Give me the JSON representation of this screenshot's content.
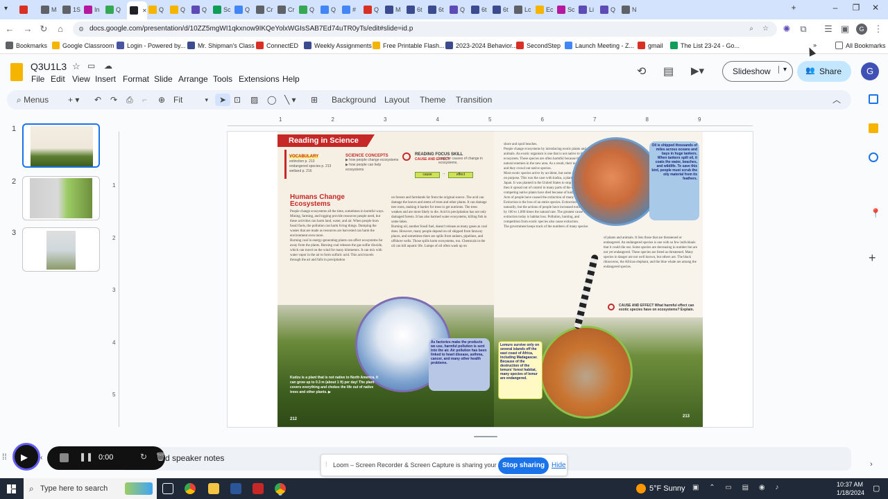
{
  "browser": {
    "tabs": [
      {
        "label": "",
        "color": "#d93025"
      },
      {
        "label": "M",
        "color": "#5f6368"
      },
      {
        "label": "1S",
        "color": "#5f6368"
      },
      {
        "label": "In",
        "color": "#b5179e"
      },
      {
        "label": "Q",
        "color": "#34a853"
      },
      {
        "label": "",
        "color": "#202124"
      },
      {
        "label": "Q",
        "color": "#f4b400"
      },
      {
        "label": "Q",
        "color": "#f4b400"
      },
      {
        "label": "Q",
        "color": "#5f4bb6"
      },
      {
        "label": "Sc",
        "color": "#0f9d58"
      },
      {
        "label": "Q",
        "color": "#4285f4"
      },
      {
        "label": "Cr",
        "color": "#5f6368"
      },
      {
        "label": "Cr",
        "color": "#5f6368"
      },
      {
        "label": "Q",
        "color": "#34a853"
      },
      {
        "label": "Q",
        "color": "#4285f4"
      },
      {
        "label": "#",
        "color": "#4285f4"
      },
      {
        "label": "Q",
        "color": "#d93025"
      },
      {
        "label": "M",
        "color": "#3c4a8f"
      },
      {
        "label": "6t",
        "color": "#3c4a8f"
      },
      {
        "label": "6t",
        "color": "#3c4a8f"
      },
      {
        "label": "Q",
        "color": "#5f4bb6"
      },
      {
        "label": "6t",
        "color": "#3c4a8f"
      },
      {
        "label": "6t",
        "color": "#3c4a8f"
      },
      {
        "label": "Lc",
        "color": "#5f6368"
      },
      {
        "label": "Ec",
        "color": "#f4b400"
      },
      {
        "label": "Sc",
        "color": "#b5179e"
      },
      {
        "label": "Li",
        "color": "#5f4bb6"
      },
      {
        "label": "Q",
        "color": "#5f4bb6"
      },
      {
        "label": "N",
        "color": "#5f6368"
      }
    ],
    "url": "docs.google.com/presentation/d/10ZZ5mgWI1qkxnow9IKQeYolxWGIsSAB7Ed74uTR0yTs/edit#slide=id.p",
    "bookmarks": [
      {
        "label": "Bookmarks",
        "color": "#5f6368"
      },
      {
        "label": "Google Classroom",
        "color": "#f4b400"
      },
      {
        "label": "Login - Powered by...",
        "color": "#4a55a2"
      },
      {
        "label": "Mr. Shipman's Class",
        "color": "#3c4a8f"
      },
      {
        "label": "ConnectED",
        "color": "#d93025"
      },
      {
        "label": "Weekly Assignments",
        "color": "#3c4a8f"
      },
      {
        "label": "Free Printable Flash...",
        "color": "#f4b400"
      },
      {
        "label": "2023-2024 Behavior...",
        "color": "#3c4a8f"
      },
      {
        "label": "SecondStep",
        "color": "#d93025"
      },
      {
        "label": "Launch Meeting - Z...",
        "color": "#4285f4"
      },
      {
        "label": "gmail",
        "color": "#d93025"
      },
      {
        "label": "The List 23-24 - Go...",
        "color": "#0f9d58"
      }
    ],
    "all_bookmarks": "All Bookmarks"
  },
  "app": {
    "title": "Q3U1L3",
    "menus": [
      "File",
      "Edit",
      "View",
      "Insert",
      "Format",
      "Slide",
      "Arrange",
      "Tools",
      "Extensions",
      "Help"
    ],
    "slideshow": "Slideshow",
    "share": "Share",
    "avatar": "G",
    "toolbar": {
      "menus_label": "Menus",
      "zoom": "Fit",
      "background": "Background",
      "layout": "Layout",
      "theme": "Theme",
      "transition": "Transition"
    },
    "slides": [
      "1",
      "2",
      "3"
    ],
    "speaker_notes": "d speaker notes",
    "ruler_h": [
      "1",
      "2",
      "3",
      "4",
      "5",
      "6",
      "7",
      "8",
      "9"
    ],
    "ruler_v": [
      "1",
      "2",
      "3",
      "4",
      "5"
    ]
  },
  "slide": {
    "banner": "Reading in Science",
    "vocab_title": "VOCABULARY",
    "vocab_items": "extinction p. 213\nendangered species p. 213\nwetland p. 216",
    "concepts_title": "SCIENCE CONCEPTS",
    "concepts_items": "▶ how people change ecosystems\n▶ how people can help ecosystems",
    "focus_title": "READING FOCUS SKILL",
    "focus_sub": "CAUSE AND EFFECT",
    "focus_desc": "Look for causes of change in ecosystems.",
    "cause": "cause",
    "effect": "effect",
    "heading": "Humans Change Ecosystems",
    "col1": "People change ecosystems all the time, sometimes in harmful ways. Mining, farming, and logging provide resources people need, but these activities can harm land, water, and air. When people burn fossil fuels, the pollution can harm living things. Dumping the wastes that are made as resources are harvested can harm the environment even more.\n   Burning coal in energy-generating plants can affect ecosystems far away from the plants. Burning coal releases the gas sulfur dioxide, which can travel on the wind for many kilometers. It can mix with water vapor in the air to form sulfuric acid. This acid travels through the air and falls in precipitation",
    "col2": "on forests and farmlands far from the original source. The acid can damage the leaves and stems of trees and other plants. It can damage tree roots, making it harder for trees to get nutrients. The trees weaken and are more likely to die. Acid in precipitation has not only damaged forests. It has also harmed water ecosystems, killing fish in some lakes.\n   Burning oil, another fossil fuel, doesn't release as many gases as coal does. However, many people depend on oil shipped from faraway places, and sometimes there are spills from tankers, pipelines, and offshore wells. Those spills harm ecosystems, too. Chemicals in the oil can kill aquatic life. Lumps of oil often wash up on",
    "col3": "shore and spoil beaches.\n   People change ecosystems by introducing exotic plants and animals. An exotic organism is one that is not native to the ecosystem. These species are often harmful because they have no natural enemies in the new area. As a result, their numbers rise, and they crowd out native species.\n   Most exotic species arrive by accident, but some are introduced on purpose. This was the case with kudzu, a plant that is native to Japan. It was planted in the United States to stop soil erosion, but then it spread out of control in many parts of the country. Many competing native plants have died because of kudzu.\n   Acts of people have caused the extinction of many species. Extinction is the loss of an entire species. Extinction does occur naturally, but the actions of people have increased extinction rates by 100 to 1,000 times the natural rate. The greatest cause of extinction today is habitat loss. Pollution, hunting, and competition from exotic species also cause extinction.\n   The government keeps track of the numbers of many species",
    "col4": "of plants and animals. It lists those that are threatened or endangered. An endangered species is one with so few individuals that it could die out. Some species are decreasing in number but are not yet endangered. These species are listed as threatened. Many species in danger are not well known, but others are. The black rhinoceros, the African elephant, and the blue whale are among the endangered species.",
    "cause_effect_q": "CAUSE AND EFFECT What harmful effect can exotic species have on ecosystems? Explain.",
    "oil_caption": "Oil is shipped thousands of miles across oceans and bays in huge tankers. When tankers spill oil, it coats the water, beaches, and wildlife. To save this bird, people must scrub the oily material from its feathers.",
    "factory_caption": "As factories make the products we use, harmful pollution is sent into the air. Air pollution has been linked to heart disease, asthma, cancer, and many other health problems.",
    "kudzu_caption": "Kudzu is a plant that is not native to North America. It can grow up to 0.3 m (about 1 ft) per day! The plant covers everything and chokes the life out of native trees and other plants. ▶",
    "lemur_caption": "Lemurs survive only on several islands off the east coast of Africa, including Madagascar. Because of the destruction of the lemurs' forest habitat, many species of lemur are endangered.",
    "page_left": "212",
    "page_right": "213"
  },
  "loom": {
    "timer": "0:00",
    "sharing": "Loom – Screen Recorder & Screen Capture is sharing your screen.",
    "stop": "Stop sharing",
    "hide": "Hide"
  },
  "taskbar": {
    "search": "Type here to search",
    "weather": "5°F  Sunny",
    "time": "10:37 AM",
    "date": "1/18/2024"
  }
}
